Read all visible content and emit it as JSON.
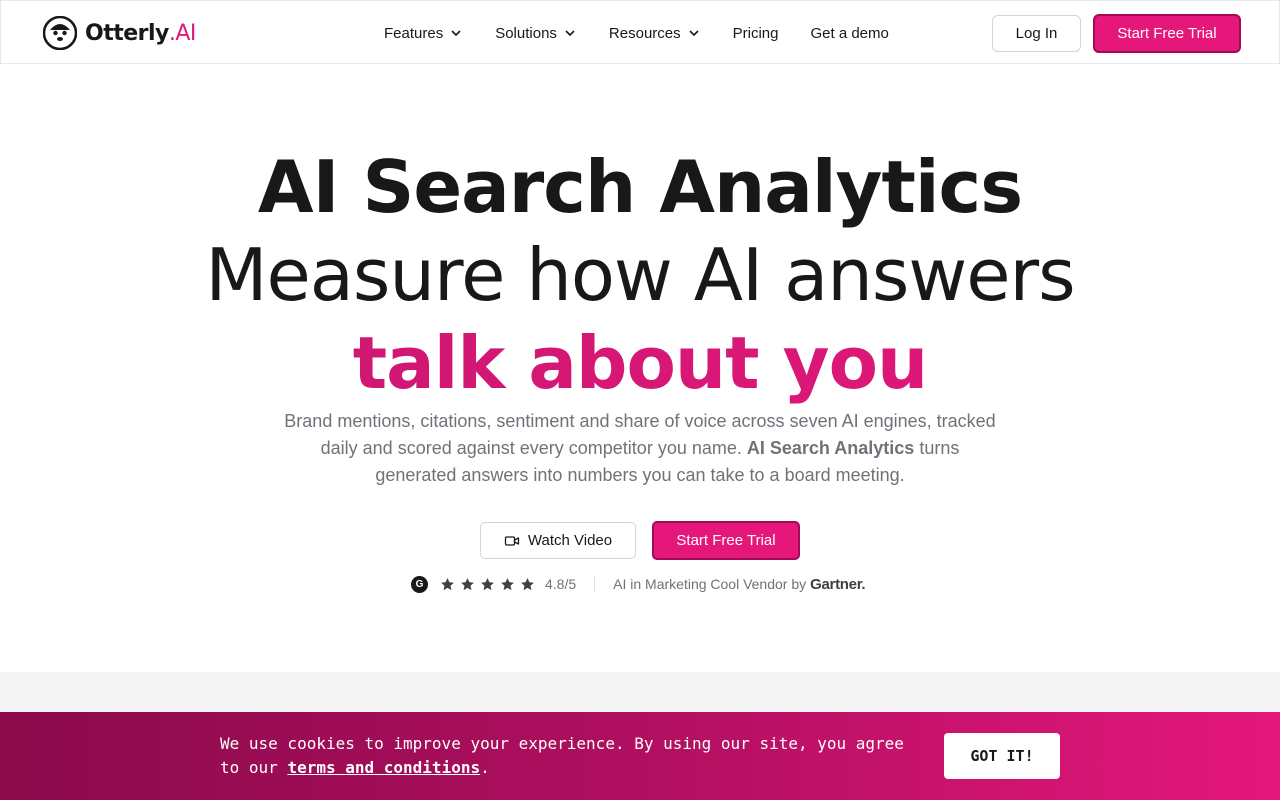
{
  "brand": {
    "name": "Otterly",
    "suffix": ".AI",
    "accent": "#e5177b"
  },
  "nav": {
    "items": [
      {
        "label": "Features",
        "dropdown": true
      },
      {
        "label": "Solutions",
        "dropdown": true
      },
      {
        "label": "Resources",
        "dropdown": true
      },
      {
        "label": "Pricing",
        "dropdown": false
      },
      {
        "label": "Get a demo",
        "dropdown": false
      }
    ],
    "login_label": "Log In",
    "trial_label": "Start Free Trial"
  },
  "hero": {
    "line1": "AI Search Analytics",
    "line2": "Measure how AI answers",
    "line3": "talk about you",
    "subtitle_part1": "Brand mentions, citations, sentiment and share of voice across seven AI engines, tracked daily and scored against every competitor you name.",
    "subtitle_bold": "AI Search Analytics",
    "subtitle_part2": "turns generated answers into numbers you can take to a board meeting.",
    "video_label": "Watch Video",
    "trial_label": "Start Free Trial"
  },
  "rating": {
    "stars": 5,
    "score": "4.8/5",
    "badge_text": "AI in Marketing Cool Vendor by",
    "badge_brand": "Gartner."
  },
  "cookie": {
    "text": "We use cookies to improve your experience. By using our site, you agree to our",
    "link": "terms and conditions",
    "end": ".",
    "button": "GOT IT!"
  }
}
